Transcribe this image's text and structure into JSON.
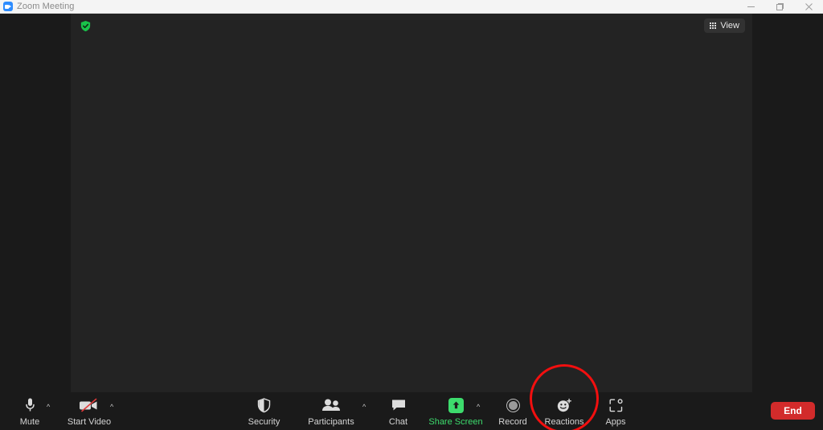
{
  "window": {
    "title": "Zoom Meeting",
    "app_icon": "zoom-camera-icon",
    "controls": [
      {
        "name": "minimize-button",
        "glyph": "minimize-icon"
      },
      {
        "name": "maximize-button",
        "glyph": "maximize-icon"
      },
      {
        "name": "close-button",
        "glyph": "close-icon"
      }
    ]
  },
  "stage": {
    "encryption_badge_icon": "green-shield-check-icon",
    "view_button": {
      "label": "View",
      "icon": "grid-view-icon"
    },
    "background_color": "#232323"
  },
  "toolbar": {
    "items": [
      {
        "label": "Mute",
        "icon": "microphone-icon",
        "caret": "^",
        "name": "mute"
      },
      {
        "label": "Start Video",
        "icon": "camera-off-icon",
        "caret": "^",
        "name": "start-video"
      },
      {
        "label": "Security",
        "icon": "shield-icon",
        "caret": "",
        "name": "security"
      },
      {
        "label": "Participants",
        "icon": "people-icon",
        "caret": "^",
        "name": "participants"
      },
      {
        "label": "Chat",
        "icon": "speech-bubble-icon",
        "caret": "",
        "name": "chat"
      },
      {
        "label": "Share Screen",
        "icon": "share-screen-up-arrow-icon",
        "caret": "^",
        "name": "share-screen"
      },
      {
        "label": "Record",
        "icon": "record-circle-icon",
        "caret": "",
        "name": "record"
      },
      {
        "label": "Reactions",
        "icon": "smiley-plus-icon",
        "caret": "",
        "name": "reactions"
      },
      {
        "label": "Apps",
        "icon": "apps-frame-icon",
        "caret": "",
        "name": "apps"
      }
    ],
    "end_button": {
      "label": "End",
      "color": "#d22b2b"
    }
  },
  "annotation": {
    "type": "circle-highlight",
    "target": "Reactions",
    "color": "#f20f0f"
  },
  "colors": {
    "titlebar_bg": "#f4f4f4",
    "window_bg": "#1a1a1a",
    "stage_bg": "#232323",
    "accent_green": "#3ddc6d",
    "zoom_blue": "#2d8cff"
  }
}
